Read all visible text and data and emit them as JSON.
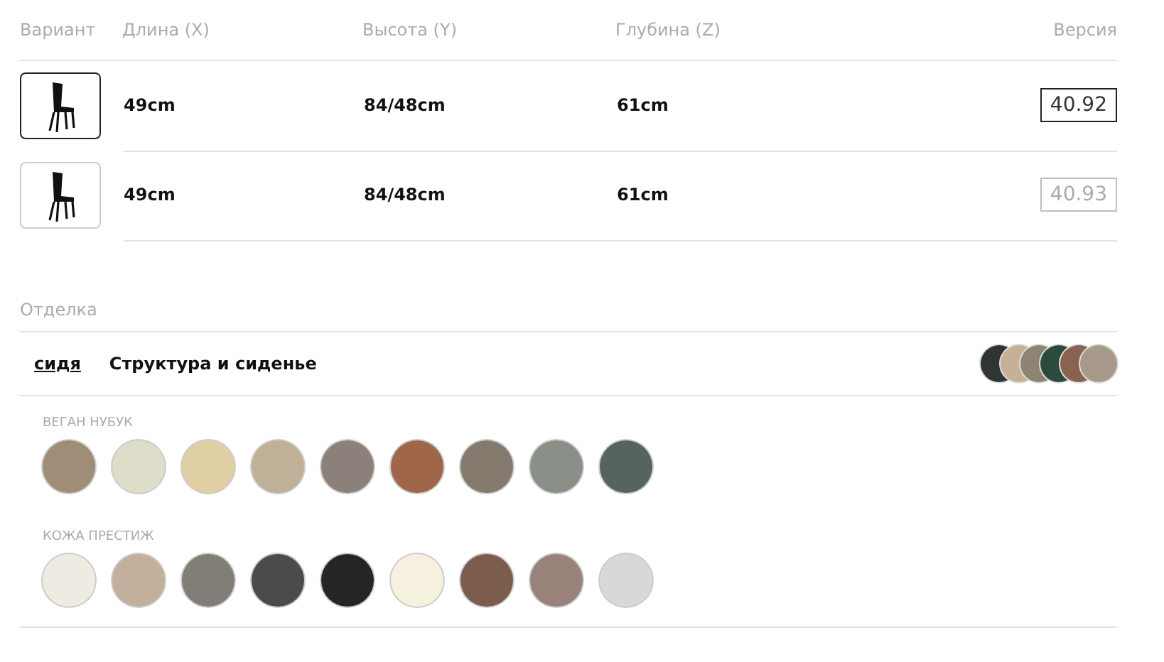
{
  "variants": {
    "columns": [
      "Вариант",
      "Длина (X)",
      "Высота (Y)",
      "Глубина (Z)",
      "Версия"
    ],
    "rows": [
      {
        "selected": true,
        "length": "49cm",
        "height": "84/48cm",
        "depth": "61cm",
        "version": "40.92"
      },
      {
        "selected": false,
        "length": "49cm",
        "height": "84/48cm",
        "depth": "61cm",
        "version": "40.93"
      }
    ]
  },
  "finish": {
    "title": "Отделка",
    "tabs": [
      {
        "label": "сидя",
        "selected": true
      },
      {
        "label": "Структура и сиденье",
        "selected": false
      }
    ],
    "preview_swatches": [
      {
        "color": "#2f3532"
      },
      {
        "color": "#c7b196"
      },
      {
        "color": "#8e8474"
      },
      {
        "color": "#2d4a3e"
      },
      {
        "color": "#8a6252"
      },
      {
        "color": "#a89a8a"
      }
    ],
    "groups": [
      {
        "name": "ВЕГАН НУБУК",
        "swatches": [
          {
            "color": "#a08d78"
          },
          {
            "color": "#deddc9"
          },
          {
            "color": "#e0cfa2"
          },
          {
            "color": "#bfb097"
          },
          {
            "color": "#8b807a"
          },
          {
            "color": "#a0664a"
          },
          {
            "color": "#857a6e"
          },
          {
            "color": "#8a9088"
          },
          {
            "color": "#56645e"
          }
        ]
      },
      {
        "name": "КОЖА ПРЕСТИЖ",
        "swatches": [
          {
            "color": "#eeebe2"
          },
          {
            "color": "#c2b09c"
          },
          {
            "color": "#807e76"
          },
          {
            "color": "#4b4b4b"
          },
          {
            "color": "#252525"
          },
          {
            "color": "#f6f0de"
          },
          {
            "color": "#7c5c4c"
          },
          {
            "color": "#98827a"
          },
          {
            "color": "#d8d8d8"
          }
        ]
      }
    ]
  }
}
